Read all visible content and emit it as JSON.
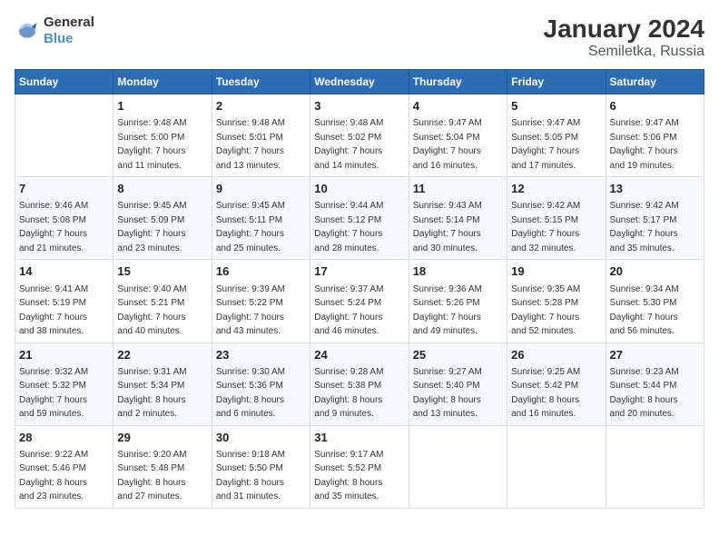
{
  "header": {
    "logo_line1": "General",
    "logo_line2": "Blue",
    "title": "January 2024",
    "subtitle": "Semiletka, Russia"
  },
  "columns": [
    "Sunday",
    "Monday",
    "Tuesday",
    "Wednesday",
    "Thursday",
    "Friday",
    "Saturday"
  ],
  "weeks": [
    [
      {
        "day": "",
        "info": ""
      },
      {
        "day": "1",
        "info": "Sunrise: 9:48 AM\nSunset: 5:00 PM\nDaylight: 7 hours\nand 11 minutes."
      },
      {
        "day": "2",
        "info": "Sunrise: 9:48 AM\nSunset: 5:01 PM\nDaylight: 7 hours\nand 13 minutes."
      },
      {
        "day": "3",
        "info": "Sunrise: 9:48 AM\nSunset: 5:02 PM\nDaylight: 7 hours\nand 14 minutes."
      },
      {
        "day": "4",
        "info": "Sunrise: 9:47 AM\nSunset: 5:04 PM\nDaylight: 7 hours\nand 16 minutes."
      },
      {
        "day": "5",
        "info": "Sunrise: 9:47 AM\nSunset: 5:05 PM\nDaylight: 7 hours\nand 17 minutes."
      },
      {
        "day": "6",
        "info": "Sunrise: 9:47 AM\nSunset: 5:06 PM\nDaylight: 7 hours\nand 19 minutes."
      }
    ],
    [
      {
        "day": "7",
        "info": "Sunrise: 9:46 AM\nSunset: 5:08 PM\nDaylight: 7 hours\nand 21 minutes."
      },
      {
        "day": "8",
        "info": "Sunrise: 9:45 AM\nSunset: 5:09 PM\nDaylight: 7 hours\nand 23 minutes."
      },
      {
        "day": "9",
        "info": "Sunrise: 9:45 AM\nSunset: 5:11 PM\nDaylight: 7 hours\nand 25 minutes."
      },
      {
        "day": "10",
        "info": "Sunrise: 9:44 AM\nSunset: 5:12 PM\nDaylight: 7 hours\nand 28 minutes."
      },
      {
        "day": "11",
        "info": "Sunrise: 9:43 AM\nSunset: 5:14 PM\nDaylight: 7 hours\nand 30 minutes."
      },
      {
        "day": "12",
        "info": "Sunrise: 9:42 AM\nSunset: 5:15 PM\nDaylight: 7 hours\nand 32 minutes."
      },
      {
        "day": "13",
        "info": "Sunrise: 9:42 AM\nSunset: 5:17 PM\nDaylight: 7 hours\nand 35 minutes."
      }
    ],
    [
      {
        "day": "14",
        "info": "Sunrise: 9:41 AM\nSunset: 5:19 PM\nDaylight: 7 hours\nand 38 minutes."
      },
      {
        "day": "15",
        "info": "Sunrise: 9:40 AM\nSunset: 5:21 PM\nDaylight: 7 hours\nand 40 minutes."
      },
      {
        "day": "16",
        "info": "Sunrise: 9:39 AM\nSunset: 5:22 PM\nDaylight: 7 hours\nand 43 minutes."
      },
      {
        "day": "17",
        "info": "Sunrise: 9:37 AM\nSunset: 5:24 PM\nDaylight: 7 hours\nand 46 minutes."
      },
      {
        "day": "18",
        "info": "Sunrise: 9:36 AM\nSunset: 5:26 PM\nDaylight: 7 hours\nand 49 minutes."
      },
      {
        "day": "19",
        "info": "Sunrise: 9:35 AM\nSunset: 5:28 PM\nDaylight: 7 hours\nand 52 minutes."
      },
      {
        "day": "20",
        "info": "Sunrise: 9:34 AM\nSunset: 5:30 PM\nDaylight: 7 hours\nand 56 minutes."
      }
    ],
    [
      {
        "day": "21",
        "info": "Sunrise: 9:32 AM\nSunset: 5:32 PM\nDaylight: 7 hours\nand 59 minutes."
      },
      {
        "day": "22",
        "info": "Sunrise: 9:31 AM\nSunset: 5:34 PM\nDaylight: 8 hours\nand 2 minutes."
      },
      {
        "day": "23",
        "info": "Sunrise: 9:30 AM\nSunset: 5:36 PM\nDaylight: 8 hours\nand 6 minutes."
      },
      {
        "day": "24",
        "info": "Sunrise: 9:28 AM\nSunset: 5:38 PM\nDaylight: 8 hours\nand 9 minutes."
      },
      {
        "day": "25",
        "info": "Sunrise: 9:27 AM\nSunset: 5:40 PM\nDaylight: 8 hours\nand 13 minutes."
      },
      {
        "day": "26",
        "info": "Sunrise: 9:25 AM\nSunset: 5:42 PM\nDaylight: 8 hours\nand 16 minutes."
      },
      {
        "day": "27",
        "info": "Sunrise: 9:23 AM\nSunset: 5:44 PM\nDaylight: 8 hours\nand 20 minutes."
      }
    ],
    [
      {
        "day": "28",
        "info": "Sunrise: 9:22 AM\nSunset: 5:46 PM\nDaylight: 8 hours\nand 23 minutes."
      },
      {
        "day": "29",
        "info": "Sunrise: 9:20 AM\nSunset: 5:48 PM\nDaylight: 8 hours\nand 27 minutes."
      },
      {
        "day": "30",
        "info": "Sunrise: 9:18 AM\nSunset: 5:50 PM\nDaylight: 8 hours\nand 31 minutes."
      },
      {
        "day": "31",
        "info": "Sunrise: 9:17 AM\nSunset: 5:52 PM\nDaylight: 8 hours\nand 35 minutes."
      },
      {
        "day": "",
        "info": ""
      },
      {
        "day": "",
        "info": ""
      },
      {
        "day": "",
        "info": ""
      }
    ]
  ]
}
